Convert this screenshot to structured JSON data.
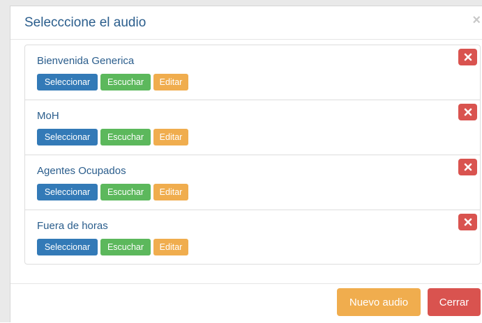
{
  "modal": {
    "title": "Selecccione el audio",
    "close_glyph": "×"
  },
  "items": [
    {
      "title": "Bienvenida Generica",
      "select_label": "Seleccionar",
      "listen_label": "Escuchar",
      "edit_label": "Editar"
    },
    {
      "title": "MoH",
      "select_label": "Seleccionar",
      "listen_label": "Escuchar",
      "edit_label": "Editar"
    },
    {
      "title": "Agentes Ocupados",
      "select_label": "Seleccionar",
      "listen_label": "Escuchar",
      "edit_label": "Editar"
    },
    {
      "title": "Fuera de horas",
      "select_label": "Seleccionar",
      "listen_label": "Escuchar",
      "edit_label": "Editar"
    }
  ],
  "footer": {
    "new_label": "Nuevo audio",
    "close_label": "Cerrar"
  },
  "icons": {
    "delete": "close-icon"
  },
  "colors": {
    "primary": "#337ab7",
    "success": "#5cb85c",
    "warning": "#f0ad4e",
    "danger": "#d9534f",
    "title": "#2a5d8c"
  }
}
